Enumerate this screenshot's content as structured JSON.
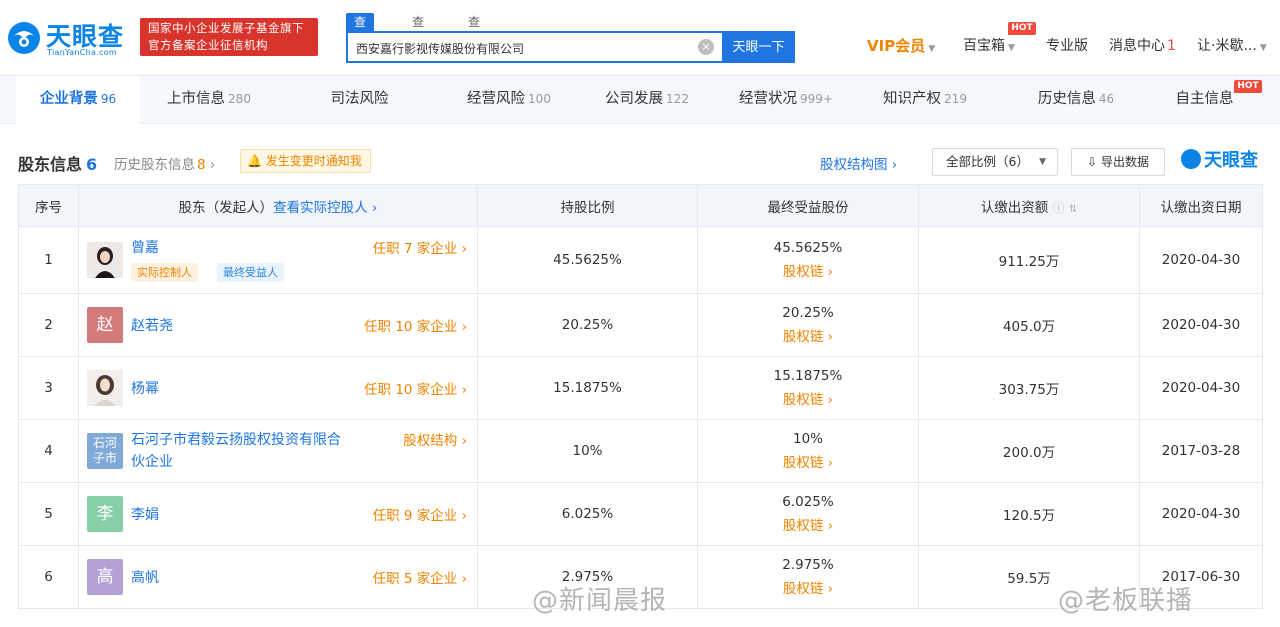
{
  "brand": {
    "name": "天眼查",
    "domain": "TianYanCha.com",
    "slogan_line1": "国家中小企业发展子基金旗下",
    "slogan_line2": "官方备案企业征信机构"
  },
  "search": {
    "tabs": [
      "查公司",
      "查老板",
      "查关系"
    ],
    "value": "西安嘉行影视传媒股份有限公司",
    "clear": "×",
    "button": "天眼一下"
  },
  "topnav": {
    "vip": "VIP会员",
    "treasure": "百宝箱",
    "hot": "HOT",
    "pro": "专业版",
    "messages": "消息中心",
    "messages_count": "1",
    "user": "让·米歇..."
  },
  "tabs": [
    {
      "label": "企业背景",
      "count": "96"
    },
    {
      "label": "上市信息",
      "count": "280"
    },
    {
      "label": "司法风险",
      "count": ""
    },
    {
      "label": "经营风险",
      "count": "100"
    },
    {
      "label": "公司发展",
      "count": "122"
    },
    {
      "label": "经营状况",
      "count": "999+"
    },
    {
      "label": "知识产权",
      "count": "219"
    },
    {
      "label": "历史信息",
      "count": "46"
    },
    {
      "label": "自主信息",
      "count": ""
    }
  ],
  "section": {
    "title": "股东信息",
    "count": "6",
    "history_label": "历史股东信息",
    "history_count": "8",
    "notify": "发生变更时通知我",
    "structure_link": "股权结构图",
    "ratio_select": "全部比例（6）",
    "export": "导出数据",
    "brand_mini": "天眼查"
  },
  "table": {
    "headers": {
      "index": "序号",
      "holder": "股东（发起人）",
      "holder_link": "查看实际控股人",
      "ratio": "持股比例",
      "final": "最终受益股份",
      "capital": "认缴出资额",
      "date": "认缴出资日期"
    },
    "chain_label": "股权链",
    "tags": {
      "controller": "实际控制人",
      "beneficiary": "最终受益人"
    },
    "rows": [
      {
        "index": "1",
        "name": "曾嘉",
        "role": "任职 7 家企业",
        "ratio": "45.5625%",
        "final": "45.5625%",
        "capital": "911.25万",
        "date": "2020-04-30"
      },
      {
        "index": "2",
        "name": "赵若尧",
        "avatar_text": "赵",
        "role": "任职 10 家企业",
        "ratio": "20.25%",
        "final": "20.25%",
        "capital": "405.0万",
        "date": "2020-04-30"
      },
      {
        "index": "3",
        "name": "杨幂",
        "role": "任职 10 家企业",
        "ratio": "15.1875%",
        "final": "15.1875%",
        "capital": "303.75万",
        "date": "2020-04-30"
      },
      {
        "index": "4",
        "name_line1": "石河子市君毅云扬股权投资有限合",
        "name_line2": "伙企业",
        "avatar_line1": "石河",
        "avatar_line2": "子市",
        "role": "股权结构",
        "ratio": "10%",
        "final": "10%",
        "capital": "200.0万",
        "date": "2017-03-28"
      },
      {
        "index": "5",
        "name": "李娟",
        "avatar_text": "李",
        "role": "任职 9 家企业",
        "ratio": "6.025%",
        "final": "6.025%",
        "capital": "120.5万",
        "date": "2020-04-30"
      },
      {
        "index": "6",
        "name": "高帆",
        "avatar_text": "高",
        "role": "任职 5 家企业",
        "ratio": "2.975%",
        "final": "2.975%",
        "capital": "59.5万",
        "date": "2017-06-30"
      }
    ]
  },
  "watermarks": [
    "@新闻晨报",
    "@老板联播"
  ],
  "colors": {
    "primary": "#1f76e2",
    "accent": "#f08300",
    "hot": "#f04b3a",
    "slogan_bg": "#d9342b"
  }
}
